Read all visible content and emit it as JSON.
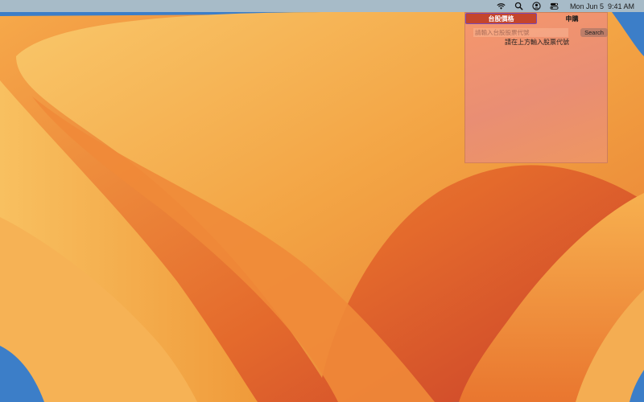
{
  "menubar": {
    "icons": [
      "wifi-icon",
      "search-icon",
      "user-icon",
      "control-center-icon"
    ],
    "date": "Mon Jun 5",
    "time": "9:41 AM"
  },
  "popover": {
    "tabs": [
      {
        "label": "台股價格",
        "active": true
      },
      {
        "label": "申購",
        "active": false
      }
    ],
    "search": {
      "placeholder": "請輸入台股股票代號",
      "value": "",
      "button_label": "Search"
    },
    "hint": "請在上方輸入股票代號"
  },
  "colors": {
    "active_tab": "#c4452d",
    "active_tab_border": "#7a4bb8",
    "wallpaper_orange": "#f19a3c",
    "wallpaper_blue": "#3c7ec8"
  }
}
